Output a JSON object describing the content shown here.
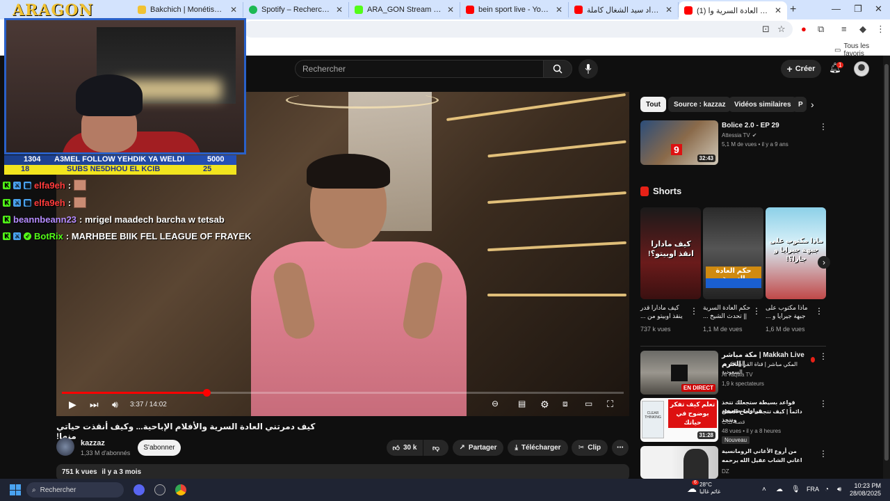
{
  "browser": {
    "tabs": [
      {
        "title": "Bakchich | Monétisation pour le",
        "color": "#f1c232"
      },
      {
        "title": "Spotify – Rechercher",
        "color": "#1db954"
      },
      {
        "title": "ARA_GON Stream - Watch Live",
        "color": "#53fc18"
      },
      {
        "title": "bein sport live - YouTube",
        "color": "#ff0000"
      },
      {
        "title": "مسرحية الواد سيد الشغال كاملة",
        "color": "#ff0000"
      },
      {
        "title": "(1) كيف دمرتني العادة السرية وا",
        "color": "#ff0000"
      }
    ],
    "bookmarks_all": "Tous les favoris"
  },
  "overlay": {
    "brand": "ARAGON",
    "bar1": {
      "left": "1304",
      "text": "A3MEL FOLLOW YEHDIK YA WELDI",
      "right": "5000"
    },
    "bar2": {
      "left": "18",
      "text": "SUBS NE5DHOU EL KCIB",
      "right": "25"
    },
    "chat": [
      {
        "user": "elfa9eh",
        "message": "",
        "user_color": "#ff3b3b",
        "emote": true
      },
      {
        "user": "elfa9eh",
        "message": "",
        "user_color": "#ff3b3b",
        "emote": true
      },
      {
        "user": "beannbeann23",
        "message": ": mrigel maadech barcha w tetsab",
        "user_color": "#b58cff",
        "emote": false
      },
      {
        "user": "BotRix",
        "message": ": MARHBEE BIIK FEL LEAGUE OF FRAYEK",
        "user_color": "#53fc18",
        "emote": false
      }
    ]
  },
  "youtube": {
    "search_placeholder": "Rechercher",
    "create_label": "Créer",
    "notif_count": "1",
    "player": {
      "current_time": "3:37 / 14:02",
      "progress": 0.258
    },
    "video": {
      "title": "كيف دمرتني العادة السرية والأفلام الإباحية... وكيف أنقذت حياتي منها!",
      "channel": "kazzaz",
      "subs": "1,33 M d'abonnés",
      "subscribe_label": "S'abonner",
      "likes": "30 k",
      "share": "Partager",
      "download": "Télécharger",
      "clip": "Clip",
      "views": "751 k vues",
      "age": "il y a 3 mois"
    },
    "chips": [
      "Tout",
      "Source : kazzaz",
      "Vidéos similaires",
      "P"
    ],
    "recommended_top": {
      "title": "Bolice 2.0 - EP 29",
      "channel": "Attessia TV",
      "meta": "5,1 M de vues • il y a 9 ans",
      "duration": "32:43"
    },
    "shorts_title": "Shorts",
    "shorts": [
      {
        "title": "كيف مادارا قدر ينقذ اوبيتو من ...",
        "views": "737 k vues",
        "overlay": "كيف مادارا انقذ اوبيتو؟!"
      },
      {
        "title": "حكم العادة السرية || تحدث الشيخ ...",
        "views": "1,1 M de vues",
        "overlay": "حكم العادة السرية"
      },
      {
        "title": "ماذا مكتوب على جبهة جيرايا و ...",
        "views": "1,6 M de vues",
        "overlay": "ماذا مكتوب على جبهة جيرايا و جارا؟!"
      }
    ],
    "recommended": [
      {
        "title_line1": "Makkah Live | مكة مباشر | الحرم",
        "title_line2": "المكي مباشر | قناة القرآن الكريم السعودية",
        "channel": "Al Taqwa TV",
        "meta": "1,9 k spectateurs",
        "badge": "EN DIRECT"
      },
      {
        "title_line1": "قواعد بسيطة ستجعلك تتخذ قرارات صحيحة",
        "title_line2": "دائماً | كيف تتجنب فخاخ العقل وتتخذ",
        "channel": "قصة كتاب",
        "meta": "48 vues • il y a 8 heures",
        "duration": "31:28",
        "tag": "Nouveau",
        "thumb_text": "تعلم كيف تفكر بوضوح في حياتك"
      },
      {
        "title_line1": "من أروع الأغاني الرومانسية",
        "title_line2": "اغاني الشاب عقيل الله يرحمه",
        "channel": "DZ"
      }
    ]
  },
  "taskbar": {
    "search": "Rechercher",
    "weather_temp": "28°C",
    "weather_desc": "غائم غالبا",
    "lang": "FRA",
    "time": "10:23 PM",
    "date": "28/08/2025",
    "weather_badge": "6"
  }
}
